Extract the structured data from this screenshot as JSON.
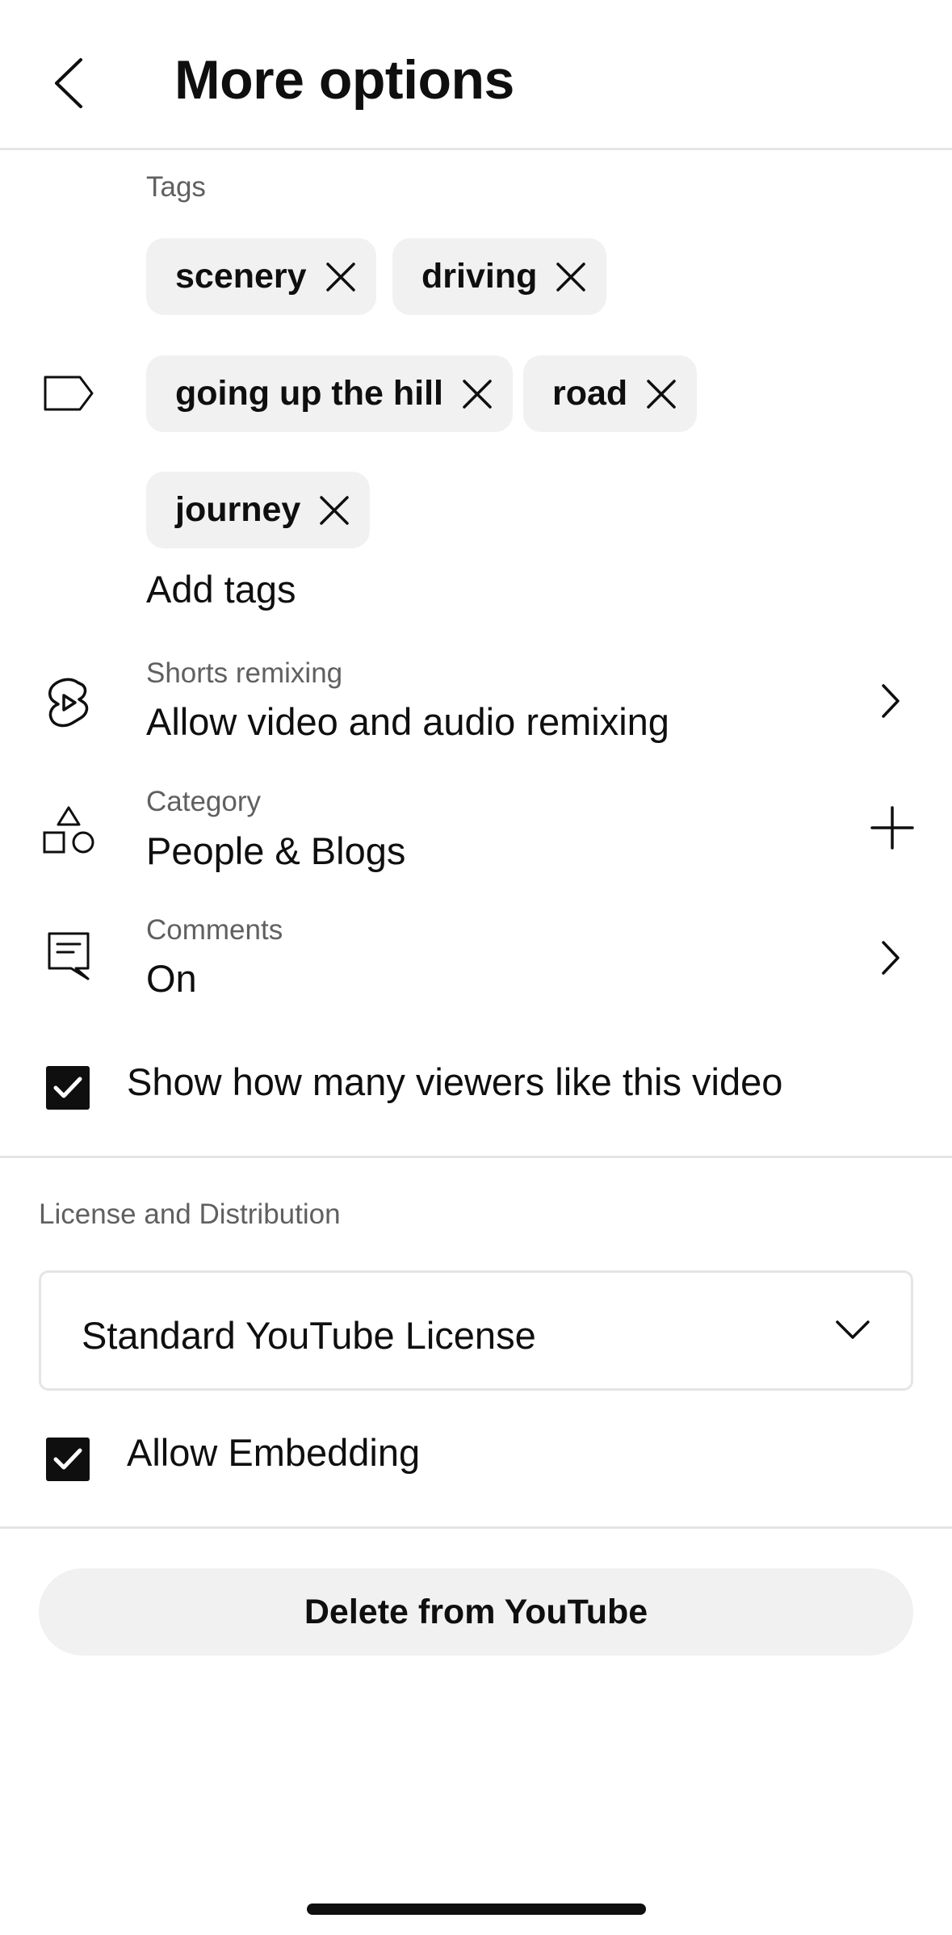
{
  "header": {
    "title": "More options"
  },
  "tags": {
    "label": "Tags",
    "items": [
      "scenery",
      "driving",
      "going up the hill",
      "road",
      "journey"
    ],
    "add_placeholder": "Add tags"
  },
  "shorts_remixing": {
    "label": "Shorts remixing",
    "value": "Allow video and audio remixing"
  },
  "category": {
    "label": "Category",
    "value": "People & Blogs"
  },
  "comments": {
    "label": "Comments",
    "value": "On"
  },
  "show_likes": {
    "label": "Show how many viewers like this video",
    "checked": true
  },
  "license": {
    "section_title": "License and Distribution",
    "selected": "Standard YouTube License"
  },
  "embedding": {
    "label": "Allow Embedding",
    "checked": true
  },
  "delete_button": {
    "label": "Delete from YouTube"
  },
  "icons": [
    "chevron-left-icon",
    "tag-icon",
    "close-icon",
    "shorts-remix-icon",
    "category-icon",
    "comment-icon",
    "chevron-right-icon",
    "plus-icon",
    "checkmark-icon",
    "chevron-down-icon"
  ]
}
